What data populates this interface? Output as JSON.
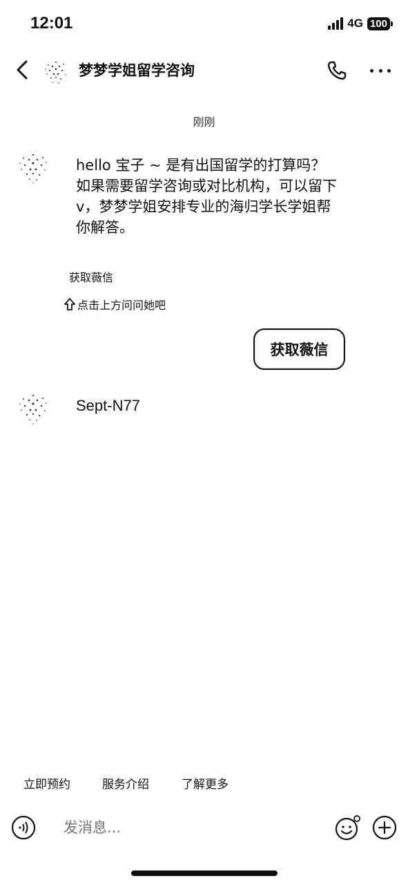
{
  "status_bar": {
    "time": "12:01",
    "network": "4G",
    "battery": "100"
  },
  "header": {
    "title": "梦梦学姐留学咨询"
  },
  "chat": {
    "timestamp": "刚刚",
    "messages": [
      {
        "text": "hello 宝子 ~ 是有出国留学的打算吗？如果需要留学咨询或对比机构，可以留下v，梦梦学姐安排专业的海归学长学姐帮你解答。"
      },
      {
        "text": "Sept-N77"
      }
    ],
    "card_label": "获取薇信",
    "hint": "点击上方问问她吧",
    "quick_button": "获取薇信"
  },
  "quick_replies": [
    "立即预约",
    "服务介绍",
    "了解更多"
  ],
  "input": {
    "placeholder": "发消息..."
  }
}
